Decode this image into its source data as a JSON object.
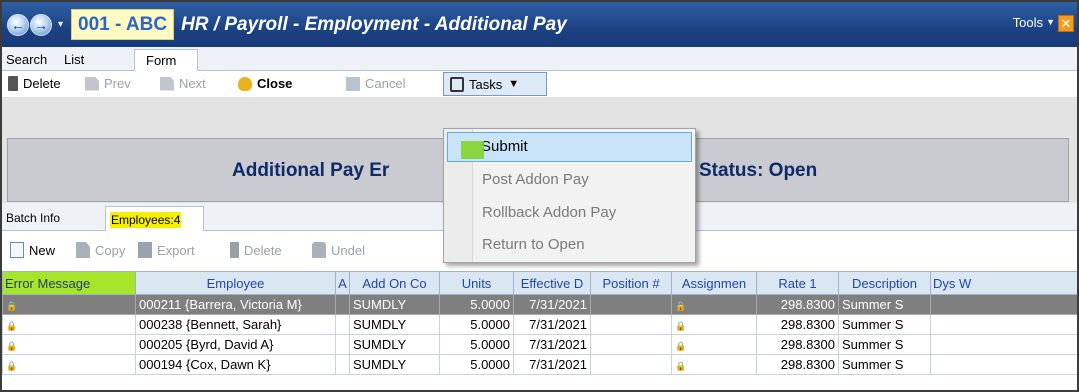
{
  "titlebar": {
    "code": "001 - ABC",
    "title": "HR / Payroll - Employment - Additional Pay",
    "tools_label": "Tools",
    "close_glyph": "✕",
    "back_glyph": "←",
    "forward_glyph": "→",
    "nav_drop_glyph": "▾"
  },
  "tabs": {
    "search": "Search",
    "list": "List",
    "form": "Form"
  },
  "toolbar": {
    "delete": "Delete",
    "prev": "Prev",
    "next": "Next",
    "close": "Close",
    "cancel": "Cancel",
    "tasks": "Tasks",
    "tasks_caret": "▼"
  },
  "header": {
    "title_partial": "Additional Pay Er",
    "status": "Status: Open"
  },
  "subtabs": {
    "batch_info": "Batch Info",
    "employees": "Employees:4"
  },
  "subtoolbar": {
    "new": "New",
    "copy": "Copy",
    "export": "Export",
    "delete": "Delete",
    "undelete": "Undel"
  },
  "tasks_menu": {
    "items": [
      "Submit",
      "Post Addon Pay",
      "Rollback Addon Pay",
      "Return to Open"
    ]
  },
  "grid": {
    "columns": [
      "Error Message",
      "Employee",
      "A",
      "Add On Co",
      "Units",
      "Effective D",
      "Position #",
      "Assignmen",
      "Rate 1",
      "Description",
      "Dys W"
    ],
    "lock_glyph": "🔒",
    "rows": [
      {
        "employee": "000211 {Barrera, Victoria M}",
        "addon": "SUMDLY",
        "units": "5.0000",
        "effective": "7/31/2021",
        "rate": "298.8300",
        "description": "Summer S"
      },
      {
        "employee": "000238 {Bennett, Sarah}",
        "addon": "SUMDLY",
        "units": "5.0000",
        "effective": "7/31/2021",
        "rate": "298.8300",
        "description": "Summer S"
      },
      {
        "employee": "000205 {Byrd, David A}",
        "addon": "SUMDLY",
        "units": "5.0000",
        "effective": "7/31/2021",
        "rate": "298.8300",
        "description": "Summer S"
      },
      {
        "employee": "000194 {Cox, Dawn K}",
        "addon": "SUMDLY",
        "units": "5.0000",
        "effective": "7/31/2021",
        "rate": "298.8300",
        "description": "Summer S"
      }
    ]
  },
  "colors": {
    "title_bar": "#1c4285",
    "highlight_green": "#a7e52a",
    "highlight_yellow": "#f7ef00",
    "header_text": "#0f2a6b",
    "selected_row": "#7f7f7f"
  }
}
